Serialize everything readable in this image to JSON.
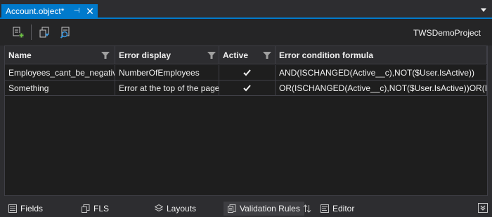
{
  "document_tab": {
    "title": "Account.object*",
    "pin_glyph": "⊣",
    "close_glyph": "✕"
  },
  "toolbar": {
    "project_name": "TWSDemoProject"
  },
  "grid": {
    "columns": [
      "Name",
      "Error display",
      "Active",
      "Error condition formula"
    ],
    "rows": [
      {
        "name": "Employees_cant_be_negative",
        "error_display": "NumberOfEmployees",
        "active": true,
        "formula": "AND(ISCHANGED(Active__c),NOT($User.IsActive))"
      },
      {
        "name": "Something",
        "error_display": "Error at the top of the page",
        "active": true,
        "formula": "OR(ISCHANGED(Active__c),NOT($User.IsActive))OR(ISCH"
      }
    ]
  },
  "bottom_tabs": [
    {
      "label": "Fields",
      "icon": "list-icon"
    },
    {
      "label": "FLS",
      "icon": "fls-icon"
    },
    {
      "label": "Layouts",
      "icon": "layouts-icon"
    },
    {
      "label": "Validation Rules",
      "icon": "validation-icon"
    },
    {
      "label": "Editor",
      "icon": "editor-icon"
    }
  ],
  "colors": {
    "accent": "#007acc",
    "background": "#2d2d30",
    "grid_background": "#1e1e1e"
  }
}
